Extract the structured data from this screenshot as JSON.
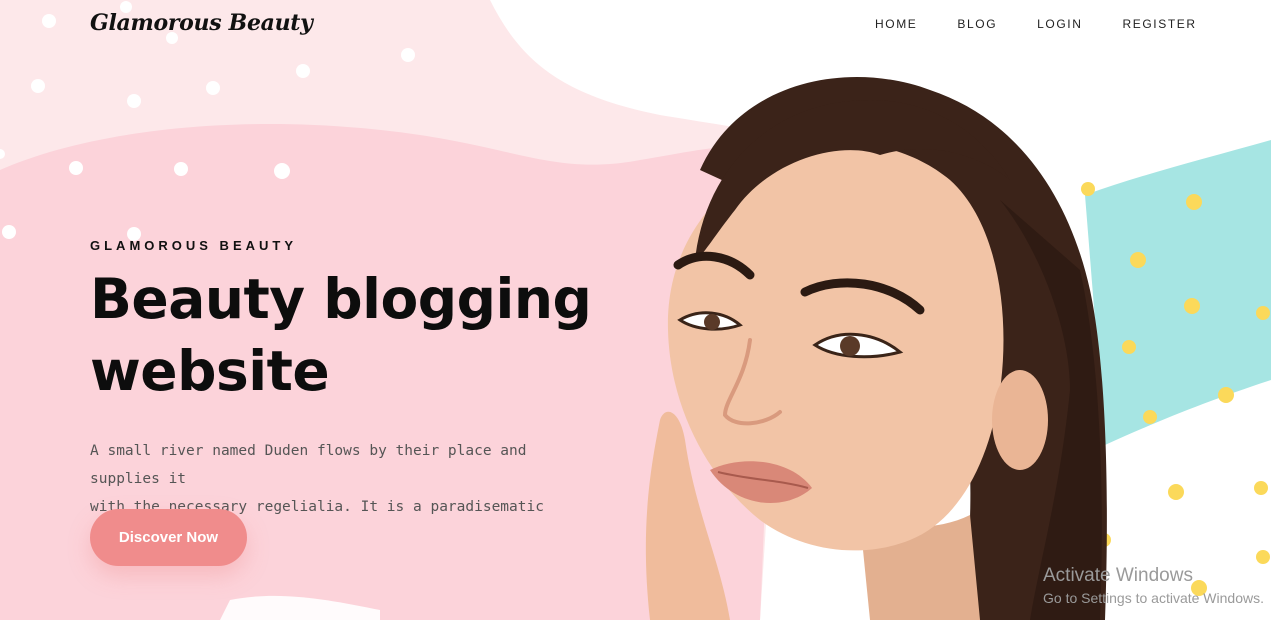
{
  "brand": {
    "logo_text": "Glamorous Beauty"
  },
  "nav": {
    "items": [
      "HOME",
      "BLOG",
      "LOGIN",
      "REGISTER"
    ]
  },
  "hero": {
    "eyebrow": "GLAMOROUS BEAUTY",
    "headline_line1": "Beauty blogging",
    "headline_line2": "website",
    "description_line1": "A small river named Duden flows by their place and supplies it",
    "description_line2": "with the necessary regelialia. It is a paradisematic country.",
    "cta_label": "Discover Now"
  },
  "watermark": {
    "title": "Activate Windows",
    "subtitle": "Go to Settings to activate Windows."
  },
  "colors": {
    "pink_light": "#fde8ea",
    "pink_main": "#fcd3da",
    "cta": "#f08c8c",
    "teal": "#a6e5e3",
    "yellow_dot": "#fbd95a"
  }
}
